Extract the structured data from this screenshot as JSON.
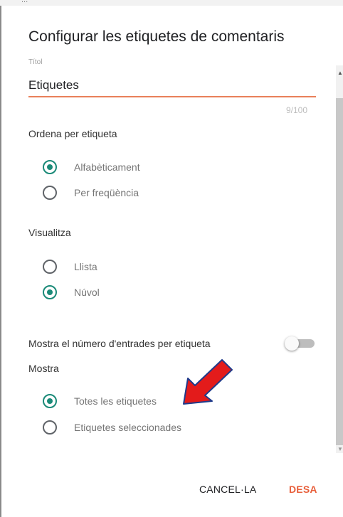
{
  "window": {
    "background_text": "..."
  },
  "dialog": {
    "title": "Configurar les etiquetes de comentaris",
    "title_field": {
      "label": "Títol",
      "value": "Etiquetes",
      "counter": "9/100",
      "underline_color": "#e9805a"
    },
    "sort": {
      "label": "Ordena per etiqueta",
      "options": [
        {
          "label": "Alfabèticament",
          "checked": true
        },
        {
          "label": "Per freqüència",
          "checked": false
        }
      ]
    },
    "display": {
      "label": "Visualitza",
      "options": [
        {
          "label": "Llista",
          "checked": false
        },
        {
          "label": "Núvol",
          "checked": true
        }
      ]
    },
    "show_count": {
      "label": "Mostra el número d'entrades per etiqueta",
      "enabled": false
    },
    "show": {
      "label": "Mostra",
      "options": [
        {
          "label": "Totes les etiquetes",
          "checked": true
        },
        {
          "label": "Etiquetes seleccionades",
          "checked": false
        }
      ]
    },
    "buttons": {
      "cancel": "CANCEL·LA",
      "save": "DESA"
    }
  },
  "colors": {
    "accent": "#1a8a78",
    "save": "#e8603c",
    "annotation_arrow": "#e31b1b"
  },
  "icons": {
    "scroll_up": "triangle-up-icon",
    "scroll_down": "triangle-down-icon",
    "annotation": "red-arrow-icon"
  }
}
